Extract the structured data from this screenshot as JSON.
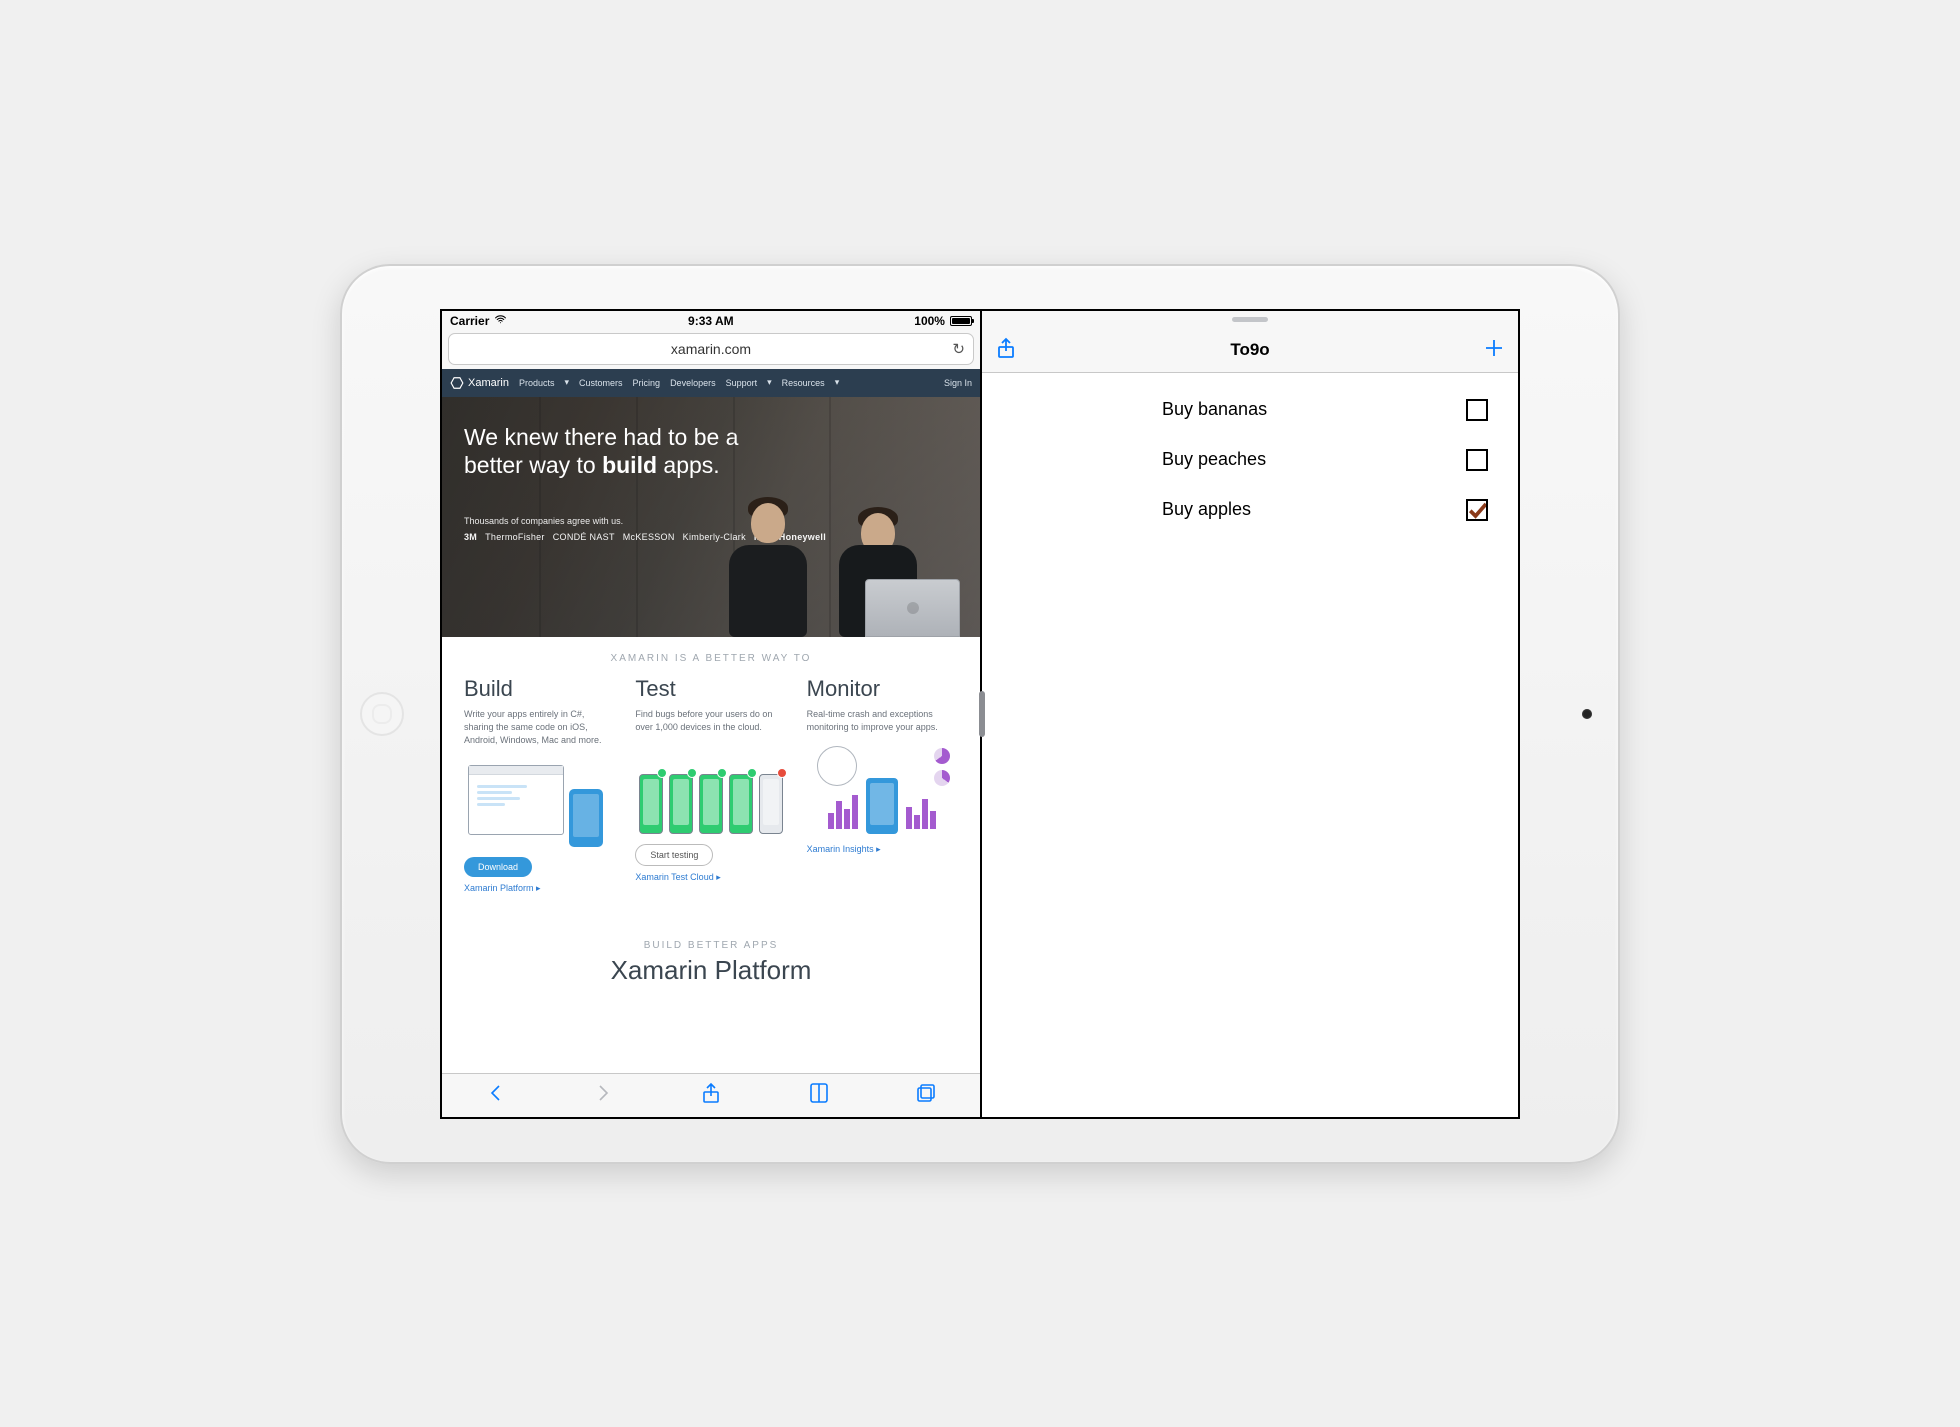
{
  "status": {
    "carrier": "Carrier",
    "time": "9:33 AM",
    "battery_pct": "100%"
  },
  "safari": {
    "url_display": "xamarin.com"
  },
  "xnav": {
    "brand": "Xamarin",
    "items": [
      "Products",
      "Customers",
      "Pricing",
      "Developers",
      "Support",
      "Resources"
    ],
    "signin": "Sign In"
  },
  "hero": {
    "line1": "We knew there had to be a",
    "line2a": "better way to ",
    "line2b": "build",
    "line2c": " apps.",
    "sub": "Thousands of companies agree with us.",
    "logos": [
      "3M",
      "ThermoFisher",
      "CONDÉ NAST",
      "McKESSON",
      "Kimberly-Clark",
      "ING",
      "Honeywell"
    ]
  },
  "tagline": "XAMARIN IS A BETTER WAY TO",
  "cols": {
    "build": {
      "h": "Build",
      "p": "Write your apps entirely in C#, sharing the same code on iOS, Android, Windows, Mac and more.",
      "btn": "Download",
      "link": "Xamarin Platform ▸"
    },
    "test": {
      "h": "Test",
      "p": "Find bugs before your users do on over 1,000 devices in the cloud.",
      "btn": "Start testing",
      "link": "Xamarin Test Cloud ▸"
    },
    "mon": {
      "h": "Monitor",
      "p": "Real-time crash and exceptions monitoring to improve your apps.",
      "link": "Xamarin Insights ▸"
    }
  },
  "platform": {
    "tag": "BUILD BETTER APPS",
    "title": "Xamarin Platform"
  },
  "todo": {
    "title": "To9o",
    "items": [
      {
        "label": "Buy bananas",
        "done": false
      },
      {
        "label": "Buy peaches",
        "done": false
      },
      {
        "label": "Buy apples",
        "done": true
      }
    ]
  }
}
